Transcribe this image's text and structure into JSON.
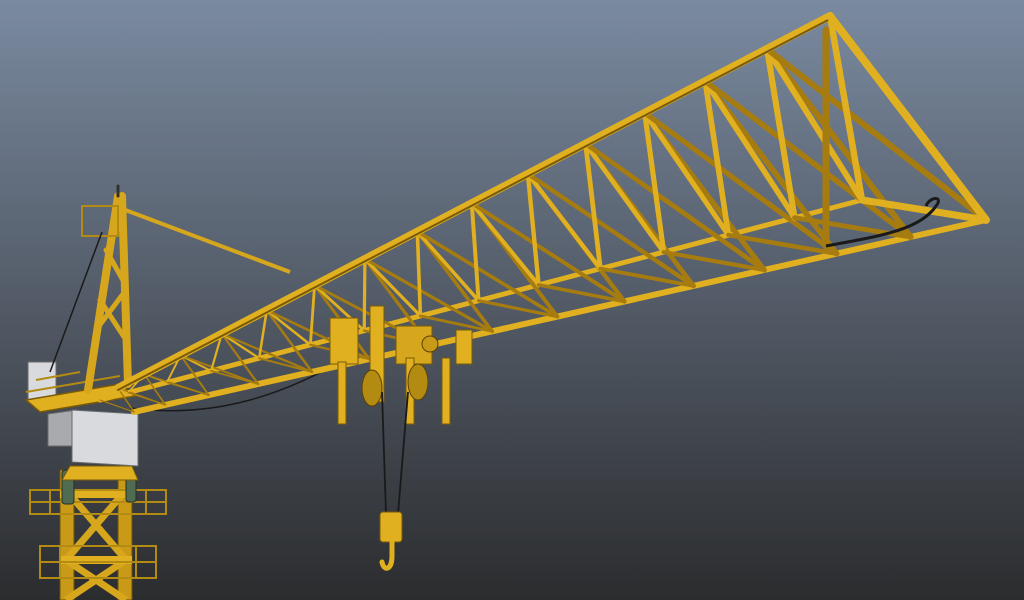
{
  "viewport": {
    "background_top": "#7a8aa0",
    "background_bottom": "#2b2c2e"
  },
  "model": {
    "name": "tower-crane",
    "colors": {
      "steel": "#e0b020",
      "steel_dark": "#a67c10",
      "steel_shadow": "#7a5a08",
      "cab": "#d9dade",
      "cab_shade": "#a9aaae",
      "cable": "#1a1a1a",
      "motor": "#4f6b52"
    }
  }
}
